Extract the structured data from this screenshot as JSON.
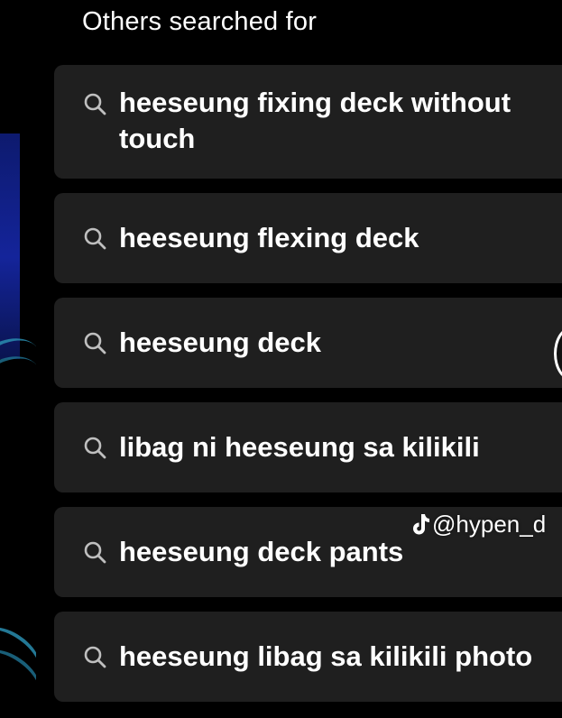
{
  "heading": "Others searched for",
  "suggestions": [
    {
      "label": "heeseung fixing deck without touch",
      "icon": "search-icon"
    },
    {
      "label": "heeseung flexing deck",
      "icon": "search-icon"
    },
    {
      "label": "heeseung deck",
      "icon": "search-icon"
    },
    {
      "label": "libag ni heeseung sa kilikili",
      "icon": "search-icon"
    },
    {
      "label": "heeseung deck pants",
      "icon": "search-icon"
    },
    {
      "label": "heeseung libag sa kilikili photo",
      "icon": "search-icon"
    }
  ],
  "watermark": {
    "icon": "tiktok-note-icon",
    "handle": "@hypen_d"
  },
  "colors": {
    "background": "#000000",
    "card": "#1f1f1f",
    "text": "#ffffff",
    "icon": "#bfbfbf"
  }
}
